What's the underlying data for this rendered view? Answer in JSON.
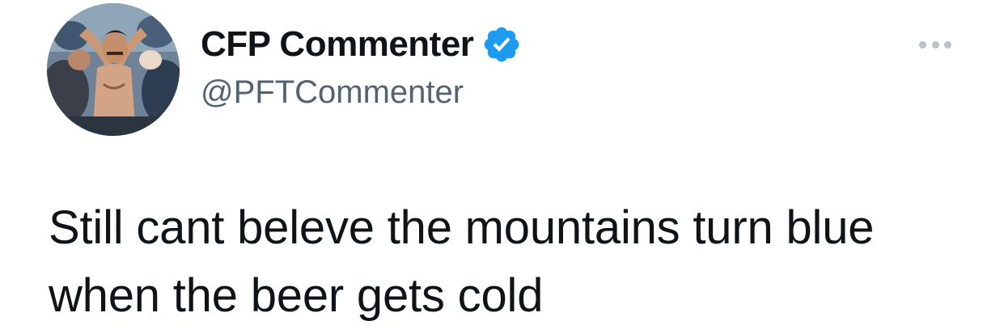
{
  "author": {
    "display_name": "CFP Commenter",
    "handle": "@PFTCommenter",
    "verified": true,
    "avatar": "shirtless-fan-avatar",
    "verified_icon": "verified-badge-icon"
  },
  "more_menu": {
    "icon": "more-options-icon"
  },
  "tweet": {
    "text": "Still cant beleve the mountains turn blue when the beer gets cold"
  },
  "colors": {
    "text_primary": "#0f1419",
    "text_secondary": "#536471",
    "verified_blue": "#1d9bf0",
    "more_dots": "#b9c2ca"
  }
}
